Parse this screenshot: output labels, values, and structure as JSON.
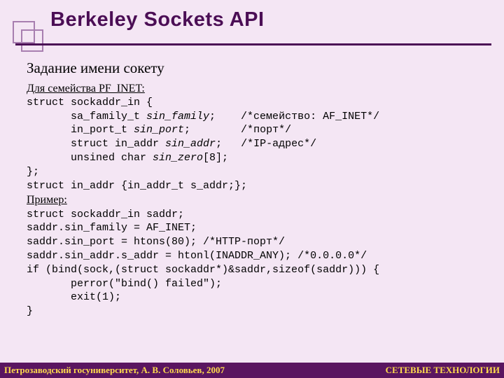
{
  "title": "Berkeley Sockets API",
  "subtitle": "Задание имени сокету",
  "label_family": "Для семейства PF_INET:",
  "code1_l1": "struct sockaddr_in {",
  "code1_l2": "       sa_family_t ",
  "code1_l2_i": "sin_family",
  "code1_l2_c": ";    /*семейство: AF_INET*/",
  "code1_l3": "       in_port_t ",
  "code1_l3_i": "sin_port",
  "code1_l3_c": ";        /*порт*/",
  "code1_l4": "       struct in_addr ",
  "code1_l4_i": "sin_addr",
  "code1_l4_c": ";   /*IP-адрес*/",
  "code1_l5": "       unsined char ",
  "code1_l5_i": "sin_zero",
  "code1_l5_c": "[8];",
  "code1_l6": "};",
  "code1_l7": "struct in_addr {in_addr_t s_addr;};",
  "label_example": "Пример:",
  "ex_l1": "struct sockaddr_in saddr;",
  "ex_l2": "saddr.sin_family = AF_INET;",
  "ex_l3": "saddr.sin_port = htons(80); /*HTTP-порт*/",
  "ex_l4": "saddr.sin_addr.s_addr = htonl(INADDR_ANY); /*0.0.0.0*/",
  "ex_l5": "if (bind(sock,(struct sockaddr*)&saddr,sizeof(saddr))) {",
  "ex_l6": "       perror(\"bind() failed\");",
  "ex_l7": "       exit(1);",
  "ex_l8": "}",
  "footer_left": "Петрозаводский госуниверситет, А. В. Соловьев, 2007",
  "footer_right": "СЕТЕВЫЕ ТЕХНОЛОГИИ"
}
